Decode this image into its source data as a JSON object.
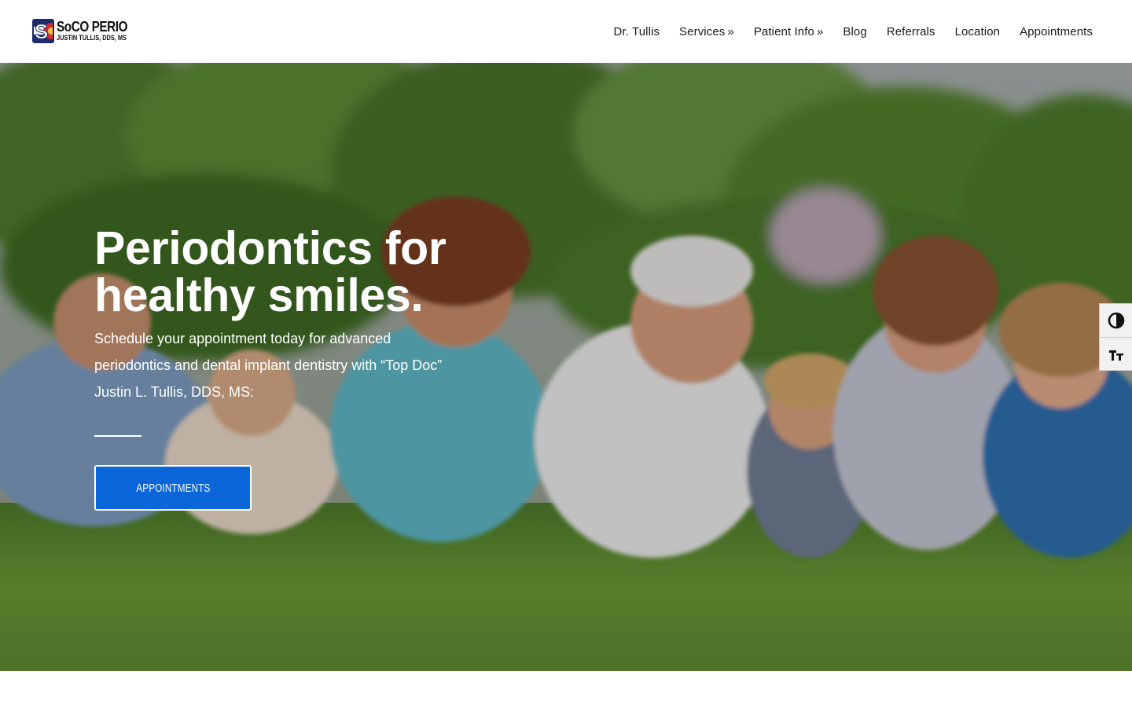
{
  "header": {
    "logo": {
      "name": "SoCO PERIO",
      "subtitle": "JUSTIN TULLIS, DDS, MS",
      "mark_letter": "S"
    },
    "nav": [
      {
        "label": "Dr. Tullis",
        "has_submenu": false
      },
      {
        "label": "Services",
        "has_submenu": true
      },
      {
        "label": "Patient Info",
        "has_submenu": true
      },
      {
        "label": "Blog",
        "has_submenu": false
      },
      {
        "label": "Referrals",
        "has_submenu": false
      },
      {
        "label": "Location",
        "has_submenu": false
      },
      {
        "label": "Appointments",
        "has_submenu": false
      }
    ],
    "submenu_indicator": "»"
  },
  "hero": {
    "title_line1": "Periodontics for",
    "title_line2": "healthy smiles.",
    "text_line1": "Schedule your appointment today for advanced",
    "text_line2": "periodontics and dental implant dentistry with “Top Doc”",
    "text_line3": "Justin L. Tullis, DDS, MS:",
    "button_label": "APPOINTMENTS"
  },
  "accessibility_tools": {
    "contrast_icon": "contrast-icon",
    "font_size_icon": "text-size-icon"
  },
  "colors": {
    "accent_blue": "#0a66d9",
    "logo_navy": "#1d2a6b",
    "logo_red": "#d62b2b",
    "logo_gold": "#f2c230"
  }
}
